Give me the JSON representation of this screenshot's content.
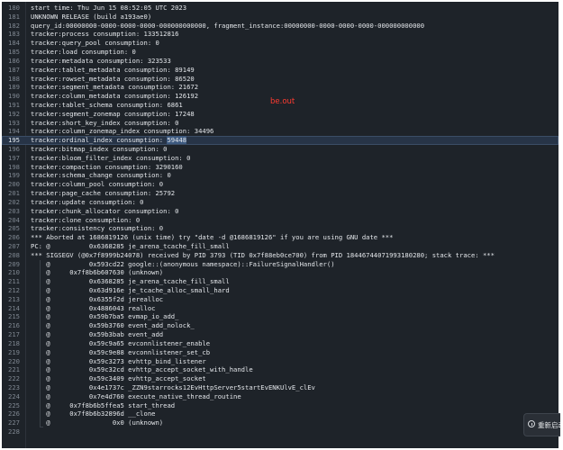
{
  "editor": {
    "active_line": 195,
    "selected_text": "59448",
    "lines": [
      {
        "n": "180",
        "text": "start time: Thu Jun 15 08:52:05 UTC 2023"
      },
      {
        "n": "181",
        "text": "UNKNOWN RELEASE (build a193ae0)"
      },
      {
        "n": "182",
        "text": "query_id:00000000-0000-0000-0000-000000000000, fragment_instance:00000000-0000-0000-0000-000000000000"
      },
      {
        "n": "183",
        "text": "tracker:process consumption: 133512816"
      },
      {
        "n": "184",
        "text": "tracker:query_pool consumption: 0"
      },
      {
        "n": "185",
        "text": "tracker:load consumption: 0"
      },
      {
        "n": "186",
        "text": "tracker:metadata consumption: 323533"
      },
      {
        "n": "187",
        "text": "tracker:tablet_metadata consumption: 89149"
      },
      {
        "n": "188",
        "text": "tracker:rowset_metadata consumption: 86520"
      },
      {
        "n": "189",
        "text": "tracker:segment_metadata consumption: 21672"
      },
      {
        "n": "190",
        "text": "tracker:column_metadata consumption: 126192"
      },
      {
        "n": "191",
        "text": "tracker:tablet_schema consumption: 6861"
      },
      {
        "n": "192",
        "text": "tracker:segment_zonemap consumption: 17248"
      },
      {
        "n": "193",
        "text": "tracker:short_key_index consumption: 0"
      },
      {
        "n": "194",
        "text": "tracker:column_zonemap_index consumption: 34496"
      },
      {
        "n": "195",
        "text": "tracker:ordinal_index consumption: ",
        "sel": "59448"
      },
      {
        "n": "196",
        "text": "tracker:bitmap_index consumption: 0"
      },
      {
        "n": "197",
        "text": "tracker:bloom_filter_index consumption: 0"
      },
      {
        "n": "198",
        "text": "tracker:compaction consumption: 3290160"
      },
      {
        "n": "199",
        "text": "tracker:schema_change consumption: 0"
      },
      {
        "n": "200",
        "text": "tracker:column_pool consumption: 0"
      },
      {
        "n": "201",
        "text": "tracker:page_cache consumption: 25792"
      },
      {
        "n": "202",
        "text": "tracker:update consumption: 0"
      },
      {
        "n": "203",
        "text": "tracker:chunk_allocator consumption: 0"
      },
      {
        "n": "204",
        "text": "tracker:clone consumption: 0"
      },
      {
        "n": "205",
        "text": "tracker:consistency consumption: 0"
      },
      {
        "n": "206",
        "text": "*** Aborted at 1686819126 (unix time) try \"date -d @1686819126\" if you are using GNU date ***"
      },
      {
        "n": "207",
        "text": "PC: @          0x6368285 je_arena_tcache_fill_small"
      },
      {
        "n": "208",
        "text": "*** SIGSEGV (@0x7f8999b24078) received by PID 3793 (TID 0x7f88eb0ce700) from PID 18446744071993180280; stack trace: ***"
      },
      {
        "n": "209",
        "text": "    @          0x593cd22 google::(anonymous namespace)::FailureSignalHandler()"
      },
      {
        "n": "210",
        "text": "    @     0x7f8b6b607630 (unknown)"
      },
      {
        "n": "211",
        "text": "    @          0x6368285 je_arena_tcache_fill_small"
      },
      {
        "n": "212",
        "text": "    @          0x63d916e je_tcache_alloc_small_hard"
      },
      {
        "n": "213",
        "text": "    @          0x6355f2d jerealloc"
      },
      {
        "n": "214",
        "text": "    @          0x4886043 realloc"
      },
      {
        "n": "215",
        "text": "    @          0x59b7ba5 evmap_io_add_"
      },
      {
        "n": "216",
        "text": "    @          0x59b3760 event_add_nolock_"
      },
      {
        "n": "217",
        "text": "    @          0x59b3bab event_add"
      },
      {
        "n": "218",
        "text": "    @          0x59c9a65 evconnlistener_enable"
      },
      {
        "n": "219",
        "text": "    @          0x59c9e88 evconnlistener_set_cb"
      },
      {
        "n": "220",
        "text": "    @          0x59c3273 evhttp_bind_listener"
      },
      {
        "n": "221",
        "text": "    @          0x59c32cd evhttp_accept_socket_with_handle"
      },
      {
        "n": "222",
        "text": "    @          0x59c3409 evhttp_accept_socket"
      },
      {
        "n": "223",
        "text": "    @          0x4e1737c _ZZN9starrocks12EvHttpServer5startEvENKUlvE_clEv"
      },
      {
        "n": "224",
        "text": "    @          0x7e4d760 execute_native_thread_routine"
      },
      {
        "n": "225",
        "text": "    @     0x7f8b6b5ffea5 start_thread"
      },
      {
        "n": "226",
        "text": "    @     0x7f8b6b32896d __clone"
      },
      {
        "n": "227",
        "text": "    @                0x0 (unknown)"
      },
      {
        "n": "228",
        "text": ""
      }
    ]
  },
  "overlay_label": "be.out",
  "overlay_color": "#ff3b30",
  "toast": {
    "icon": "info-icon",
    "text": "重新启动"
  }
}
